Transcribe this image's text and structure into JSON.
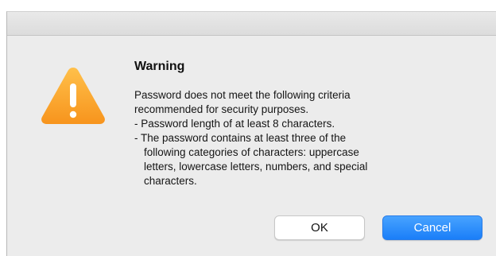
{
  "dialog": {
    "title": "Warning",
    "icon": "warning-icon",
    "message": {
      "line1": "Password does not meet the following criteria",
      "line2": "recommended for security purposes.",
      "line3": "- Password length of at least 8 characters.",
      "line4": "- The password contains at least three of the",
      "line5": "following categories of characters: uppercase",
      "line6": "letters, lowercase letters, numbers, and special",
      "line7": "characters."
    },
    "buttons": {
      "ok_label": "OK",
      "cancel_label": "Cancel"
    }
  },
  "colors": {
    "icon_orange": "#f7941d",
    "icon_orange_light": "#ffc04a",
    "primary_button": "#1a7ef8",
    "background": "#ececec"
  }
}
